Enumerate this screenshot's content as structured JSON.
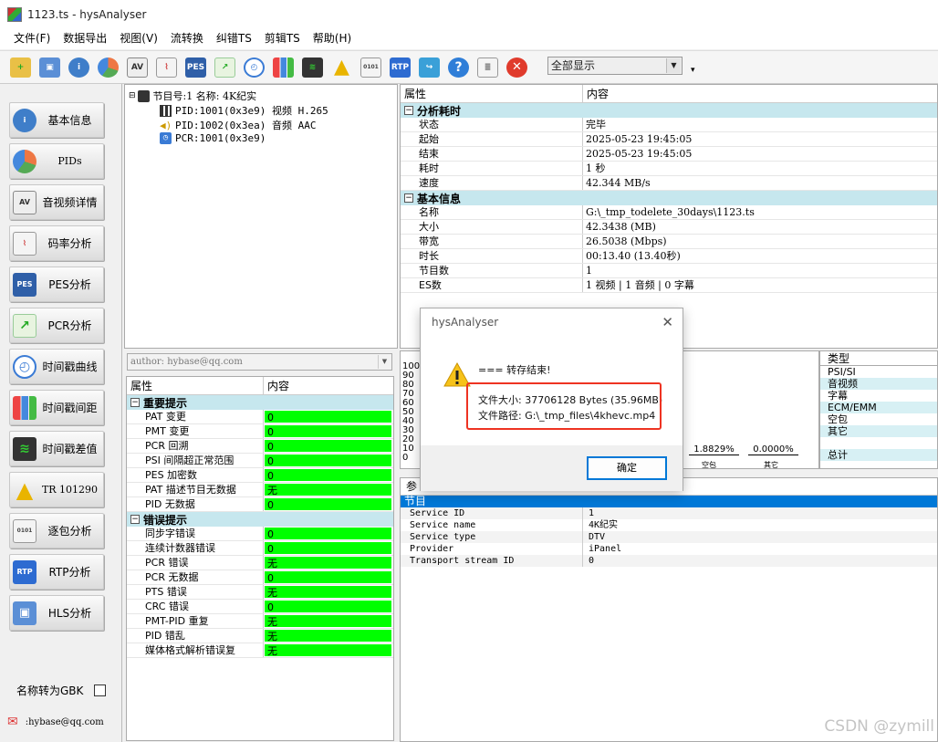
{
  "window": {
    "title": "1123.ts - hysAnalyser"
  },
  "menu": [
    "文件(F)",
    "数据导出",
    "视图(V)",
    "流转换",
    "纠错TS",
    "剪辑TS",
    "帮助(H)"
  ],
  "toolbar": {
    "icons": [
      "open-folder-icon",
      "network-icon",
      "info-icon",
      "pie-icon",
      "av-icon",
      "line-chart-icon",
      "pes-icon",
      "pcr-icon",
      "clock-icon",
      "bar-chart-icon",
      "stripes-icon",
      "warning-icon",
      "binary-icon",
      "rtp-icon",
      "export-icon",
      "help-icon",
      "table-icon",
      "stop-icon"
    ],
    "display_combo": "全部显示",
    "more": "▾"
  },
  "sidebar": {
    "items": [
      {
        "label": "基本信息",
        "icon": "info-icon"
      },
      {
        "label": "PIDs",
        "icon": "pie-icon"
      },
      {
        "label": "音视频详情",
        "icon": "av-icon"
      },
      {
        "label": "码率分析",
        "icon": "line-chart-icon"
      },
      {
        "label": "PES分析",
        "icon": "pes-icon"
      },
      {
        "label": "PCR分析",
        "icon": "pcr-icon"
      },
      {
        "label": "时间戳曲线",
        "icon": "clock-icon"
      },
      {
        "label": "时间戳间距",
        "icon": "bar-chart-icon"
      },
      {
        "label": "时间戳差值",
        "icon": "stripes-icon"
      },
      {
        "label": "TR 101290",
        "icon": "warning-icon"
      },
      {
        "label": "逐包分析",
        "icon": "binary-icon"
      },
      {
        "label": "RTP分析",
        "icon": "rtp-icon"
      },
      {
        "label": "HLS分析",
        "icon": "network-icon"
      }
    ],
    "gbk_label": "名称转为GBK",
    "email": ":hybase@qq.com"
  },
  "tree": {
    "program": "节目号:1 名称: 4K纪实",
    "streams": [
      "PID:1001(0x3e9) 视频 H.265",
      "PID:1002(0x3ea) 音频 AAC",
      "PCR:1001(0x3e9)"
    ]
  },
  "author_combo": "author: hybase@qq.com",
  "errtable": {
    "col1": "属性",
    "col2": "内容",
    "sections": [
      {
        "title": "重要提示",
        "rows": [
          [
            "PAT 变更",
            "0"
          ],
          [
            "PMT 变更",
            "0"
          ],
          [
            "PCR 回溯",
            "0"
          ],
          [
            "PSI 间隔超正常范围",
            "0"
          ],
          [
            "PES 加密数",
            "0"
          ],
          [
            "PAT 描述节目无数据",
            "无"
          ],
          [
            "PID 无数据",
            "0"
          ]
        ]
      },
      {
        "title": "错误提示",
        "rows": [
          [
            "同步字错误",
            "0"
          ],
          [
            "连续计数器错误",
            "0"
          ],
          [
            "PCR 错误",
            "无"
          ],
          [
            "PCR 无数据",
            "0"
          ],
          [
            "PTS 错误",
            "无"
          ],
          [
            "CRC 错误",
            "0"
          ],
          [
            "PMT-PID 重复",
            "无"
          ],
          [
            "PID 错乱",
            "无"
          ],
          [
            "媒体格式解析错误复",
            "无"
          ]
        ]
      }
    ]
  },
  "props": {
    "col1": "属性",
    "col2": "内容",
    "sections": [
      {
        "title": "分析耗时",
        "rows": [
          [
            "状态",
            "完毕"
          ],
          [
            "起始",
            "2025-05-23 19:45:05"
          ],
          [
            "结束",
            "2025-05-23 19:45:05"
          ],
          [
            "耗时",
            "1 秒"
          ],
          [
            "速度",
            "42.344 MB/s"
          ]
        ]
      },
      {
        "title": "基本信息",
        "rows": [
          [
            "名称",
            "G:\\_tmp_todelete_30days\\1123.ts"
          ],
          [
            "大小",
            "42.3438 (MB)"
          ],
          [
            "带宽",
            "26.5038 (Mbps)"
          ],
          [
            "时长",
            "00:13.40 (13.40秒)"
          ],
          [
            "节目数",
            "1"
          ],
          [
            "ES数",
            "1 视频 | 1 音频 | 0 字幕"
          ]
        ]
      }
    ]
  },
  "chart": {
    "yticks": [
      "100",
      "90",
      "80",
      "70",
      "60",
      "50",
      "40",
      "30",
      "20",
      "10",
      "0"
    ],
    "labels": [
      "1.8829%",
      "0.0000%"
    ],
    "cats": [
      "空包",
      "其它"
    ]
  },
  "types": {
    "header": "类型",
    "items": [
      "PSI/SI",
      "音视频",
      "字幕",
      "ECM/EMM",
      "空包",
      "其它",
      "",
      "总计"
    ]
  },
  "params": {
    "header": "参",
    "section": "节目",
    "rows": [
      [
        "Service ID",
        "1"
      ],
      [
        "Service name",
        "4K纪实"
      ],
      [
        "Service type",
        "DTV"
      ],
      [
        "Provider",
        "iPanel"
      ],
      [
        "Transport stream ID",
        "0"
      ]
    ]
  },
  "dialog": {
    "title": "hysAnalyser",
    "close": "✕",
    "heading": "=== 转存结束!",
    "size": "文件大小: 37706128 Bytes (35.96MB)",
    "path": "文件路径: G:\\_tmp_files\\4khevc.mp4",
    "ok": "确定"
  },
  "watermark": "CSDN @zymill"
}
